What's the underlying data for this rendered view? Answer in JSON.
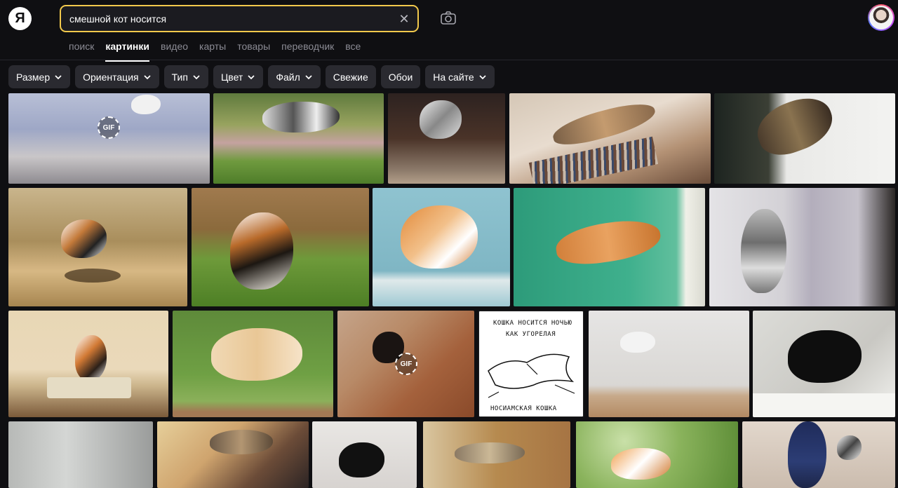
{
  "logo": {
    "text": "Я"
  },
  "search": {
    "query": "смешной кот носится",
    "clear_icon": "close-icon"
  },
  "tabs": [
    {
      "label": "поиск",
      "active": false
    },
    {
      "label": "картинки",
      "active": true
    },
    {
      "label": "видео",
      "active": false
    },
    {
      "label": "карты",
      "active": false
    },
    {
      "label": "товары",
      "active": false
    },
    {
      "label": "переводчик",
      "active": false
    },
    {
      "label": "все",
      "active": false
    }
  ],
  "filters": [
    {
      "label": "Размер",
      "dropdown": true
    },
    {
      "label": "Ориентация",
      "dropdown": true
    },
    {
      "label": "Тип",
      "dropdown": true
    },
    {
      "label": "Цвет",
      "dropdown": true
    },
    {
      "label": "Файл",
      "dropdown": true
    },
    {
      "label": "Свежие",
      "dropdown": false
    },
    {
      "label": "Обои",
      "dropdown": false
    },
    {
      "label": "На сайте",
      "dropdown": true
    }
  ],
  "badges": {
    "gif": "GIF"
  },
  "comic": {
    "line1": "КОШКА НОСИТСЯ НОЧЬЮ",
    "line2": "КАК УГОРЕЛАЯ",
    "caption": "НОСИАМСКАЯ КОШКА"
  },
  "colors": {
    "accent": "#f2c94c",
    "background": "#0f0f12",
    "chip": "#2a2a30"
  }
}
